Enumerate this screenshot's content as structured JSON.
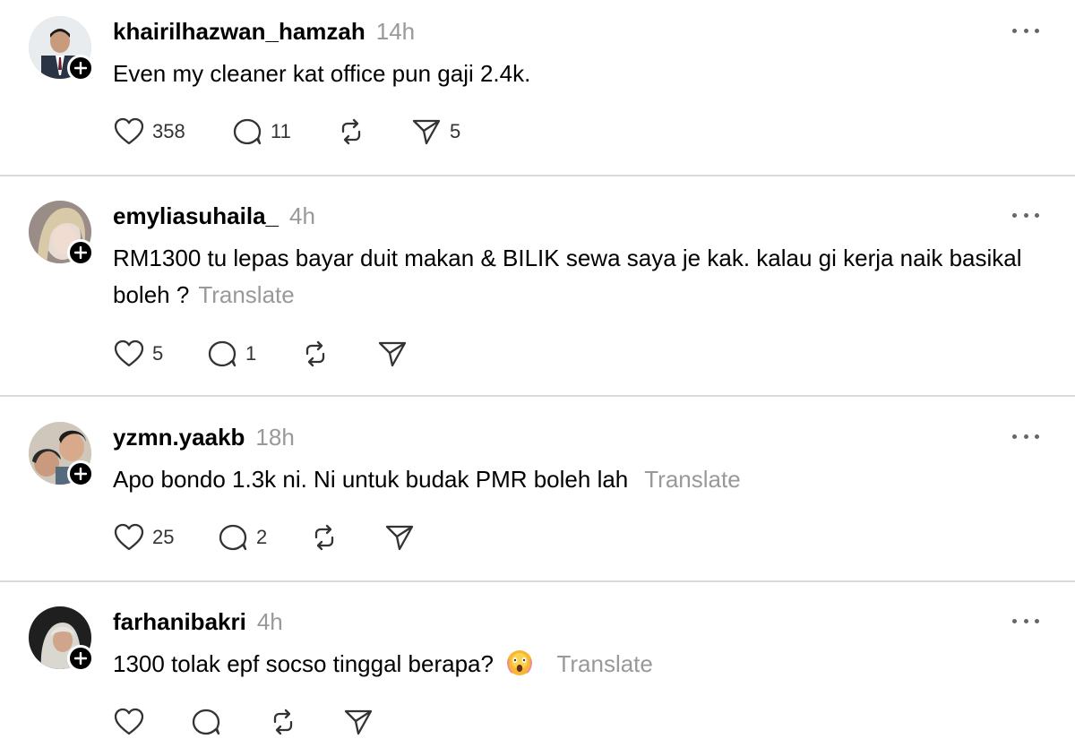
{
  "posts": [
    {
      "username": "khairilhazwan_hamzah",
      "time": "14h",
      "text": "Even my cleaner kat office pun gaji 2.4k.",
      "translate": "",
      "likes": "358",
      "replies": "11",
      "reposts": "",
      "shares": "5"
    },
    {
      "username": "emyliasuhaila_",
      "time": "4h",
      "text": "RM1300 tu lepas bayar duit makan & BILIK sewa saya je kak. kalau gi kerja naik basikal boleh ?",
      "translate": "Translate",
      "likes": "5",
      "replies": "1",
      "reposts": "",
      "shares": ""
    },
    {
      "username": "yzmn.yaakb",
      "time": "18h",
      "text": "Apo bondo 1.3k ni. Ni untuk budak PMR boleh lah",
      "translate": "Translate",
      "likes": "25",
      "replies": "2",
      "reposts": "",
      "shares": ""
    },
    {
      "username": "farhanibakri",
      "time": "4h",
      "text": "1300 tolak epf socso tinggal berapa?",
      "translate": "Translate",
      "likes": "",
      "replies": "",
      "reposts": "",
      "shares": ""
    }
  ],
  "icons": {
    "like": "heart-icon",
    "reply": "speech-bubble-icon",
    "repost": "repost-icon",
    "share": "send-icon",
    "more": "more-horizontal-icon",
    "follow": "plus-icon",
    "emoji": "screaming-face-emoji-icon"
  },
  "colors": {
    "text": "#000000",
    "muted": "#999999",
    "icon": "#333333",
    "divider": "#d9d9d9"
  }
}
